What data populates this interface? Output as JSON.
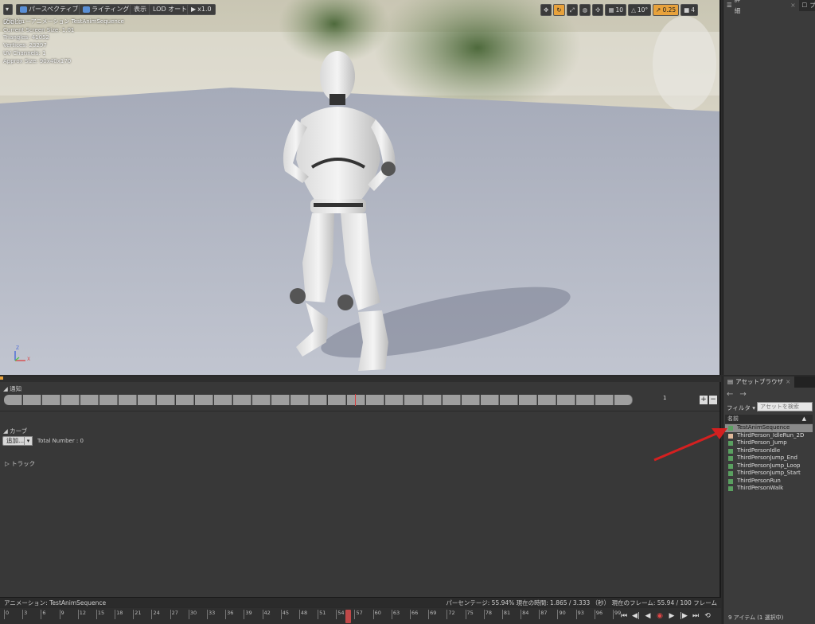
{
  "viewport": {
    "toolbar": {
      "menu_icon": "chevron-down-icon",
      "perspective_label": "パースペクティブ",
      "lighting_label": "ライティング",
      "show_label": "表示",
      "lod_label": "LOD オート",
      "speed_label": "x1.0"
    },
    "title": "プレビューアニメーション TestAnimSequence",
    "stats": [
      "LOD: 0",
      "Current Screen Size: 1.01",
      "Triangles: 41052",
      "Vertices: 23297",
      "UV Channels: 1",
      "Approx Size: 90x40x170"
    ],
    "right_tools": {
      "grid_value": "10",
      "angle_value": "10°",
      "scale_value": "0.25",
      "camera_value": "4"
    },
    "axis": {
      "z": "Z",
      "x": "X"
    }
  },
  "details_panel": {
    "tab_label": "詳細",
    "tab2_label": "プ"
  },
  "anim_editor": {
    "notify_label": "通知",
    "notify_track_number": "1",
    "curves_label": "カーブ",
    "add_label": "追加...",
    "total_number": "Total Number : 0",
    "tracks_label": "トラック",
    "status_left": "アニメーション: TestAnimSequence",
    "status_right": "パーセンテージ: 55.94% 現在の時間: 1.865 / 3.333 （秒） 現在のフレーム: 55.94 / 100 フレーム"
  },
  "timeline": {
    "ticks": [
      "0",
      "3",
      "6",
      "9",
      "12",
      "15",
      "18",
      "21",
      "24",
      "27",
      "30",
      "33",
      "36",
      "39",
      "42",
      "45",
      "48",
      "51",
      "54",
      "57",
      "60",
      "63",
      "66",
      "69",
      "72",
      "75",
      "78",
      "81",
      "84",
      "87",
      "90",
      "93",
      "96",
      "99"
    ],
    "playhead_frame": 55.94,
    "total_frames": 100
  },
  "asset_browser": {
    "tab_label": "アセットブラウザ",
    "filter_label": "フィルタ ▾",
    "search_placeholder": "アセットを検索",
    "column_name": "名前",
    "assets": [
      {
        "name": "TestAnimSequence",
        "selected": true
      },
      {
        "name": "ThirdPerson_IdleRun_2D",
        "selected": false
      },
      {
        "name": "ThirdPerson_Jump",
        "selected": false
      },
      {
        "name": "ThirdPersonIdle",
        "selected": false
      },
      {
        "name": "ThirdPersonJump_End",
        "selected": false
      },
      {
        "name": "ThirdPersonJump_Loop",
        "selected": false
      },
      {
        "name": "ThirdPersonJump_Start",
        "selected": false
      },
      {
        "name": "ThirdPersonRun",
        "selected": false
      },
      {
        "name": "ThirdPersonWalk",
        "selected": false
      }
    ],
    "item_count": "9 アイテム (1 選択中)"
  },
  "colors": {
    "accent": "#e8a23c",
    "annotation_arrow": "#d42020",
    "playhead": "#c04848",
    "floor": "#b8bdc9"
  }
}
